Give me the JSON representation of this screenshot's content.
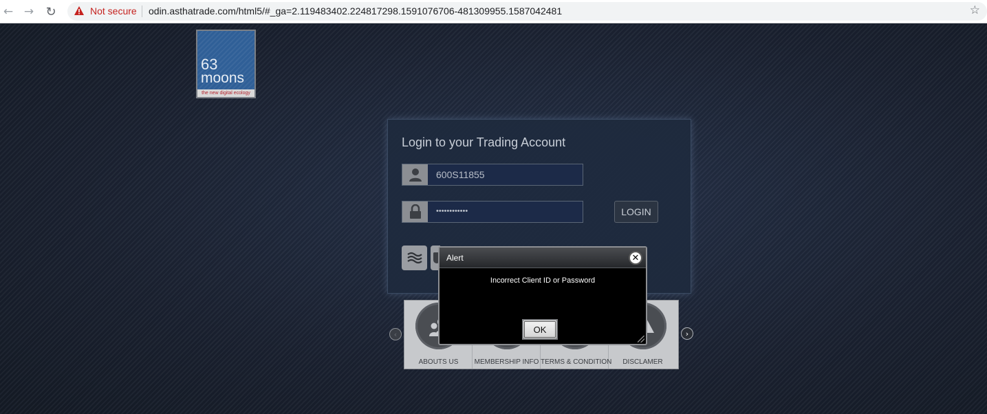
{
  "browser": {
    "back_icon": "arrow-left-icon",
    "forward_icon": "arrow-right-icon",
    "reload_icon": "reload-icon",
    "security_label": "Not secure",
    "url": "odin.asthatrade.com/html5/#_ga=2.119483402.224817298.1591076706-481309955.1587042481",
    "bookmark_icon": "star-icon"
  },
  "logo": {
    "line1": "63",
    "line2": "moons",
    "tagline": "the new digital ecology"
  },
  "login": {
    "title": "Login to your Trading Account",
    "client_id": "600S11855",
    "password_mask": "••••••••••••",
    "login_label": "LOGIN"
  },
  "info_strip": {
    "items": [
      {
        "label": "ABOUTS US"
      },
      {
        "label": "MEMBERSHIP INFO"
      },
      {
        "label": "TERMS & CONDITION"
      },
      {
        "label": "DISCLAMER"
      }
    ]
  },
  "alert": {
    "title": "Alert",
    "message": "Incorrect Client ID or Password",
    "ok_label": "OK"
  },
  "colors": {
    "accent_red": "#c5221f",
    "logo_blue": "#2f5f97",
    "page_bg": "#1b2331"
  }
}
